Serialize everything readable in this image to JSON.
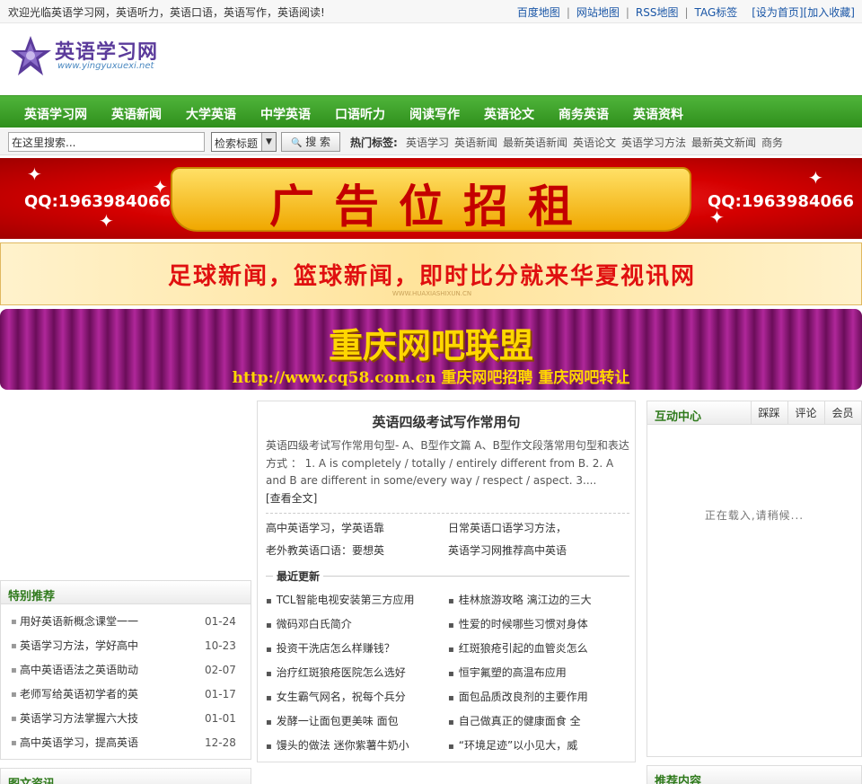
{
  "topbar": {
    "welcome": "欢迎光临英语学习网，英语听力，英语口语，英语写作，英语阅读!",
    "links": [
      "百度地图",
      "网站地图",
      "RSS地图",
      "TAG标签"
    ],
    "set_home": "[设为首页]",
    "add_fav": "[加入收藏]"
  },
  "logo": {
    "title": "英语学习网",
    "url": "www.yingyuxuexi.net"
  },
  "nav": [
    "英语学习网",
    "英语新闻",
    "大学英语",
    "中学英语",
    "口语听力",
    "阅读写作",
    "英语论文",
    "商务英语",
    "英语资料"
  ],
  "search": {
    "placeholder": "在这里搜索...",
    "select_value": "检索标题",
    "button": "搜 索",
    "hot_label": "热门标签:",
    "hot_tags": [
      "英语学习",
      "英语新闻",
      "最新英语新闻",
      "英语论文",
      "英语学习方法",
      "最新英文新闻",
      "商务"
    ]
  },
  "banners": {
    "b1_text": "广告位招租",
    "b1_qq_left": "QQ:1963984066",
    "b1_qq_right": "QQ:1963984066",
    "b2_text": "足球新闻，篮球新闻，即时比分就来华夏视讯网",
    "b2_small": "WWW.HUAXIASHIXUN.CN",
    "b3_title": "重庆网吧联盟",
    "b3_sub": "http://www.cq58.com.cn 重庆网吧招聘 重庆网吧转让"
  },
  "special": {
    "title": "特别推荐",
    "items": [
      {
        "text": "用好英语新概念课堂一一",
        "date": "01-24"
      },
      {
        "text": "英语学习方法，学好高中",
        "date": "10-23"
      },
      {
        "text": "高中英语语法之英语助动",
        "date": "02-07"
      },
      {
        "text": "老师写给英语初学者的英",
        "date": "01-17"
      },
      {
        "text": "英语学习方法掌握六大技",
        "date": "01-01"
      },
      {
        "text": "高中英语学习，提高英语",
        "date": "12-28"
      }
    ]
  },
  "bottom_left_title": "图文资讯",
  "article": {
    "headline": "英语四级考试写作常用句",
    "summary": "英语四级考试写作常用句型- A、B型作文篇 A、B型作文段落常用句型和表达方式 ： 1. A is completely / totally / entirely different from B. 2. A and B are different in some/every way / respect / aspect. 3....",
    "more": "[查看全文]",
    "pairs": [
      "高中英语学习，学英语靠",
      "日常英语口语学习方法，",
      "老外教英语口语：要想英",
      "英语学习网推荐高中英语"
    ]
  },
  "recent": {
    "title": "最近更新",
    "bullet": "▪",
    "left": [
      "TCL智能电视安装第三方应用",
      "微码邓白氏简介",
      "投资干洗店怎么样赚钱？",
      "治疗红斑狼疮医院怎么选好",
      "女生霸气网名，祝每个兵分",
      "发酵一让面包更美味 面包",
      "馒头的做法 迷你紫薯牛奶小"
    ],
    "right": [
      "桂林旅游攻略 漓江边的三大",
      "性爱的时候哪些习惯对身体",
      "红斑狼疮引起的血管炎怎么",
      "恒宇氟塑的高温布应用",
      "面包品质改良剂的主要作用",
      "自己做真正的健康面食 全",
      "“环境足迹”以小见大，威"
    ]
  },
  "interactive": {
    "title": "互动中心",
    "tabs": [
      "踩踩",
      "评论",
      "会员"
    ],
    "loading": "正在载入,请稍候..."
  },
  "bottom_right_title": "推荐内容"
}
